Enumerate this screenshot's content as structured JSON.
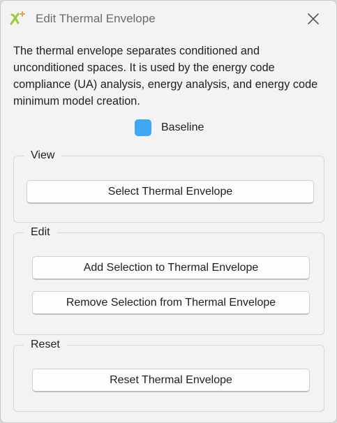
{
  "window": {
    "title": "Edit Thermal Envelope",
    "app_logo_icon": "xn-logo-icon",
    "close_icon": "close-icon"
  },
  "description": "The thermal envelope separates conditioned and unconditioned spaces. It is used by the energy code compliance (UA) analysis, energy analysis, and energy code minimum model creation.",
  "baseline": {
    "label": "Baseline",
    "color": "#3ea8f5"
  },
  "groups": {
    "view": {
      "title": "View",
      "select_button": "Select Thermal Envelope"
    },
    "edit": {
      "title": "Edit",
      "add_button": "Add Selection to Thermal Envelope",
      "remove_button": "Remove Selection from Thermal Envelope"
    },
    "reset": {
      "title": "Reset",
      "reset_button": "Reset Thermal Envelope"
    }
  },
  "colors": {
    "logo_green": "#9ccc3c",
    "logo_orange": "#e8a33a"
  }
}
